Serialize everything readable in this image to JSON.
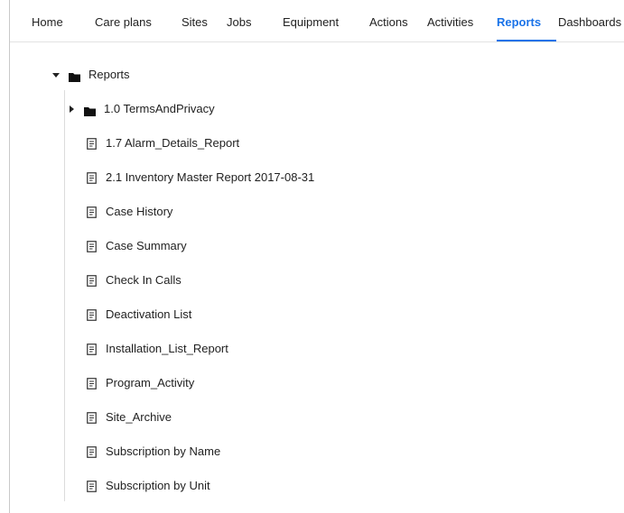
{
  "nav": {
    "items": [
      {
        "label": "Home"
      },
      {
        "label": "Care plans"
      },
      {
        "label": "Sites"
      },
      {
        "label": "Jobs"
      },
      {
        "label": "Equipment"
      },
      {
        "label": "Actions"
      },
      {
        "label": "Activities"
      },
      {
        "label": "Reports"
      },
      {
        "label": "Dashboards"
      }
    ],
    "active": "Reports"
  },
  "tree": {
    "root": {
      "label": "Reports",
      "expanded": true
    },
    "folders": [
      {
        "label": "1.0 TermsAndPrivacy",
        "expanded": false
      }
    ],
    "reports": [
      {
        "label": "1.7 Alarm_Details_Report"
      },
      {
        "label": "2.1 Inventory Master Report 2017-08-31"
      },
      {
        "label": "Case History"
      },
      {
        "label": "Case Summary"
      },
      {
        "label": "Check In Calls"
      },
      {
        "label": "Deactivation List"
      },
      {
        "label": "Installation_List_Report"
      },
      {
        "label": "Program_Activity"
      },
      {
        "label": "Site_Archive"
      },
      {
        "label": "Subscription by Name"
      },
      {
        "label": "Subscription by Unit"
      }
    ]
  },
  "colors": {
    "accent": "#1a73e8",
    "text": "#1f1f1f",
    "icon": "#222222"
  }
}
